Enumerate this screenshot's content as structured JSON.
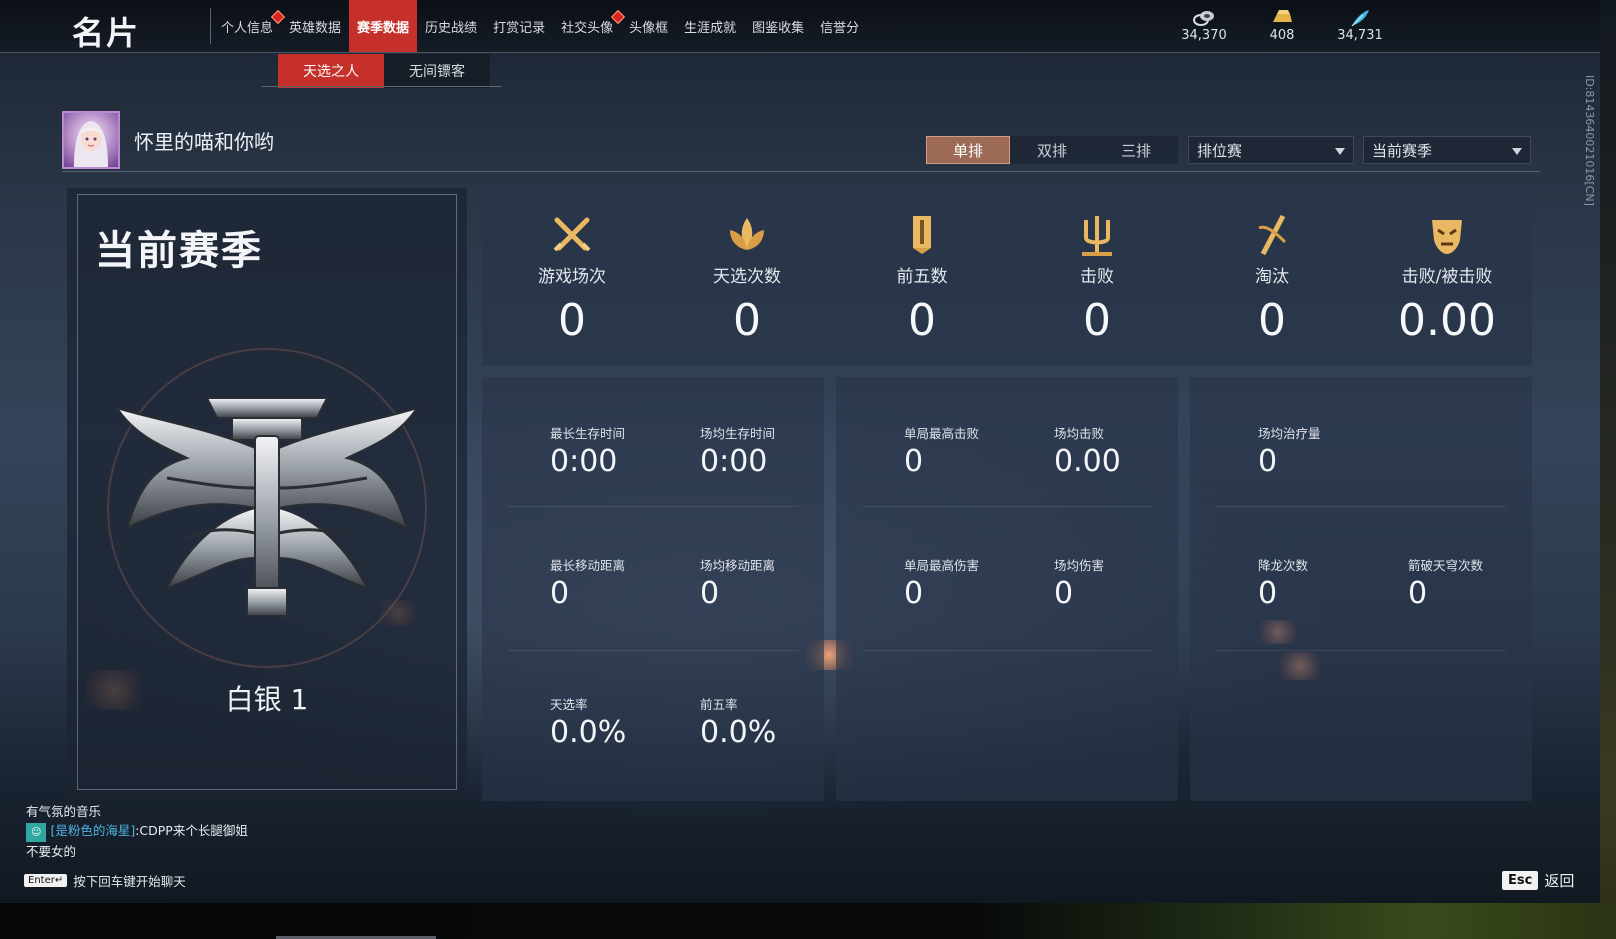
{
  "header": {
    "title": "名片",
    "nav": [
      {
        "label": "个人信息",
        "badge": true
      },
      {
        "label": "英雄数据",
        "badge": false
      },
      {
        "label": "赛季数据",
        "badge": false,
        "active": true
      },
      {
        "label": "历史战绩",
        "badge": false
      },
      {
        "label": "打赏记录",
        "badge": false
      },
      {
        "label": "社交头像",
        "badge": true
      },
      {
        "label": "头像框",
        "badge": false
      },
      {
        "label": "生涯成就",
        "badge": false
      },
      {
        "label": "图鉴收集",
        "badge": false
      },
      {
        "label": "信誉分",
        "badge": false
      }
    ],
    "currencies": [
      {
        "icon": "coin-stack-icon",
        "value": "34,370"
      },
      {
        "icon": "gold-ingot-icon",
        "value": "408"
      },
      {
        "icon": "feather-icon",
        "value": "34,731"
      }
    ]
  },
  "subnav": [
    {
      "label": "天选之人",
      "active": true
    },
    {
      "label": "无间镖客",
      "active": false
    }
  ],
  "profile": {
    "username": "怀里的喵和你哟"
  },
  "filters": {
    "modes": [
      {
        "label": "单排",
        "active": true
      },
      {
        "label": "双排",
        "active": false
      },
      {
        "label": "三排",
        "active": false
      }
    ],
    "match_type": "排位赛",
    "season": "当前赛季"
  },
  "rank": {
    "season_label": "当前赛季",
    "rank_name": "白银 1"
  },
  "summary_stats": [
    {
      "icon": "crossed-swords-icon",
      "label": "游戏场次",
      "value": "0"
    },
    {
      "icon": "lotus-icon",
      "label": "天选次数",
      "value": "0"
    },
    {
      "icon": "banner-icon",
      "label": "前五数",
      "value": "0"
    },
    {
      "icon": "trident-icon",
      "label": "击败",
      "value": "0"
    },
    {
      "icon": "slash-icon",
      "label": "淘汰",
      "value": "0"
    },
    {
      "icon": "mask-icon",
      "label": "击败/被击败",
      "value": "0.00"
    }
  ],
  "panels": {
    "survival": {
      "longest_survival_label": "最长生存时间",
      "longest_survival": "0:00",
      "avg_survival_label": "场均生存时间",
      "avg_survival": "0:00",
      "longest_move_label": "最长移动距离",
      "longest_move": "0",
      "avg_move_label": "场均移动距离",
      "avg_move": "0",
      "win_rate_label": "天选率",
      "win_rate": "0.0%",
      "top5_rate_label": "前五率",
      "top5_rate": "0.0%"
    },
    "combat": {
      "max_kills_label": "单局最高击败",
      "max_kills": "0",
      "avg_kills_label": "场均击败",
      "avg_kills": "0.00",
      "max_damage_label": "单局最高伤害",
      "max_damage": "0",
      "avg_damage_label": "场均伤害",
      "avg_damage": "0"
    },
    "misc": {
      "avg_heal_label": "场均治疗量",
      "avg_heal": "0",
      "dragon_label": "降龙次数",
      "dragon": "0",
      "arrow_label": "箭破天穹次数",
      "arrow": "0"
    }
  },
  "chat": {
    "line1": "有气氛的音乐",
    "line2_tag": "☺",
    "line2_name": "[是粉色的海星]",
    "line2_text": ":CDPP来个长腿御姐",
    "line3": "不要女的",
    "hint_key": "Enter↵",
    "hint_text": "按下回车键开始聊天"
  },
  "footer": {
    "esc_key": "Esc",
    "esc_label": "返回"
  },
  "player_id": "ID:8143640021016[CN]"
}
